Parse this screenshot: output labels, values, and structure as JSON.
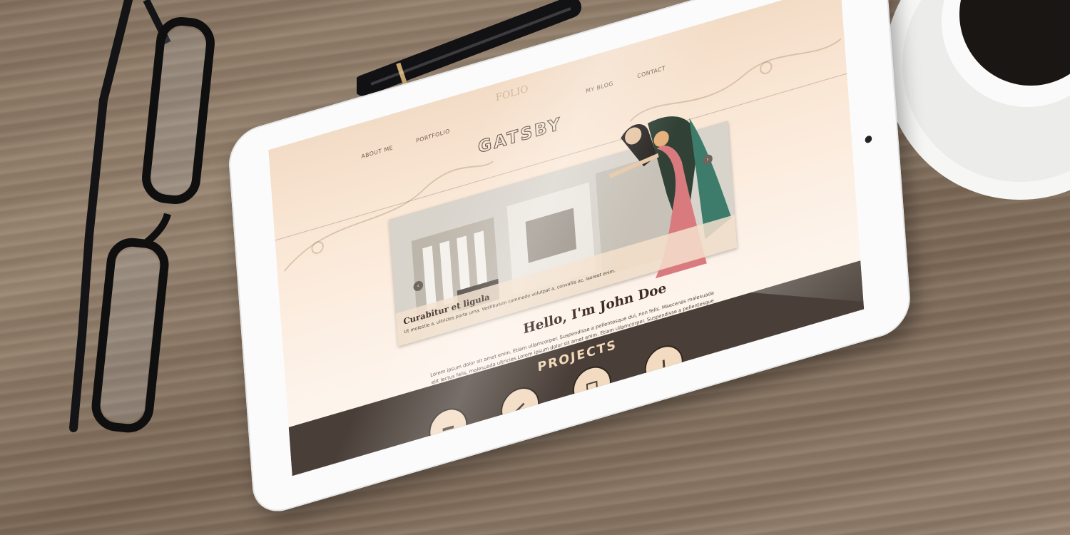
{
  "website": {
    "nav": {
      "about": "ABOUT ME",
      "portfolio": "PORTFOLIO",
      "blog": "MY BLOG",
      "contact": "CONTACT"
    },
    "logo_mark": "FOLIO",
    "brand": "GATSBY",
    "slider": {
      "caption_title": "Curabitur et ligula",
      "caption_text": "Ut molestie a, ultricies porta urna. Vestibulum commodo volutpat a, convallis ac, laoreet enim."
    },
    "hello_heading": "Hello, I'm John Doe",
    "intro_text": "Lorem ipsum dolor sit amet enim. Etiam ullamcorper. Suspendisse a pellentesque dui, non felis. Maecenas malesuada elit lectus felis, malesuada ultricies.Lorem ipsum dolor sit amet enim. Etiam ullamcorper. Suspendisse a pellentesque dui, non felis. Maecenas malesuada elit lectus felis, malesuada ultricies.",
    "projects_heading": "PROJECTS"
  },
  "colors": {
    "screen_bg": "#f3dcc6",
    "band": "#4a3f38",
    "accent_text": "#3e2c24",
    "projects_text": "#f2d8b8"
  },
  "icons": [
    "glasses-icon",
    "pen-icon",
    "coffee-cup-icon",
    "prev-arrow-icon",
    "next-arrow-icon",
    "project-icon"
  ]
}
